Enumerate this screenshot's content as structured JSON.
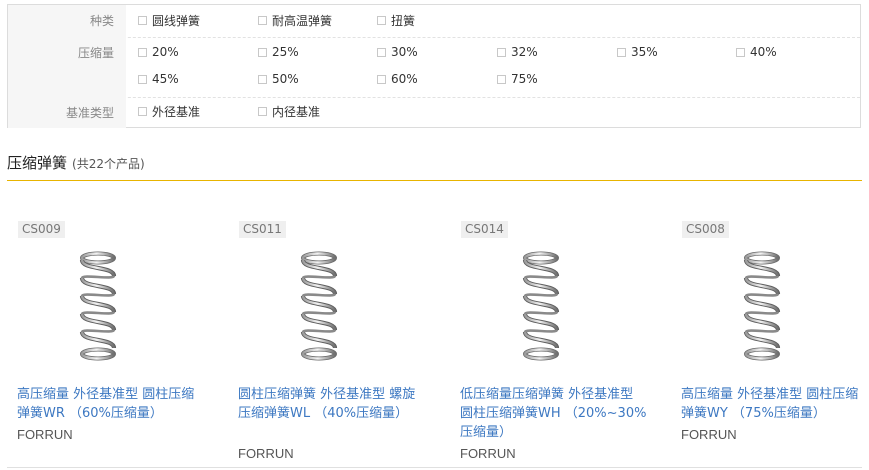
{
  "filters": [
    {
      "label": "种类",
      "options": [
        "圆线弹簧",
        "耐高温弹簧",
        "扭簧"
      ]
    },
    {
      "label": "压缩量",
      "options": [
        "20%",
        "25%",
        "30%",
        "32%",
        "35%",
        "40%",
        "45%",
        "50%",
        "60%",
        "75%"
      ]
    },
    {
      "label": "基准类型",
      "options": [
        "外径基准",
        "内径基准"
      ]
    }
  ],
  "section": {
    "title": "压缩弹簧",
    "count": "(共22个产品)"
  },
  "products": [
    {
      "code": "CS009",
      "title": "高压缩量 外径基准型 圆柱压缩弹簧WR （60%压缩量）",
      "brand": "FORRUN"
    },
    {
      "code": "CS011",
      "title": "圆柱压缩弹簧 外径基准型 螺旋压缩弹簧WL （40%压缩量）",
      "brand": "FORRUN"
    },
    {
      "code": "CS014",
      "title": "低压缩量压缩弹簧 外径基准型 圆柱压缩弹簧WH （20%~30%压缩量）",
      "brand": "FORRUN"
    },
    {
      "code": "CS008",
      "title": "高压缩量 外径基准型 圆柱压缩弹簧WY （75%压缩量）",
      "brand": "FORRUN"
    }
  ]
}
